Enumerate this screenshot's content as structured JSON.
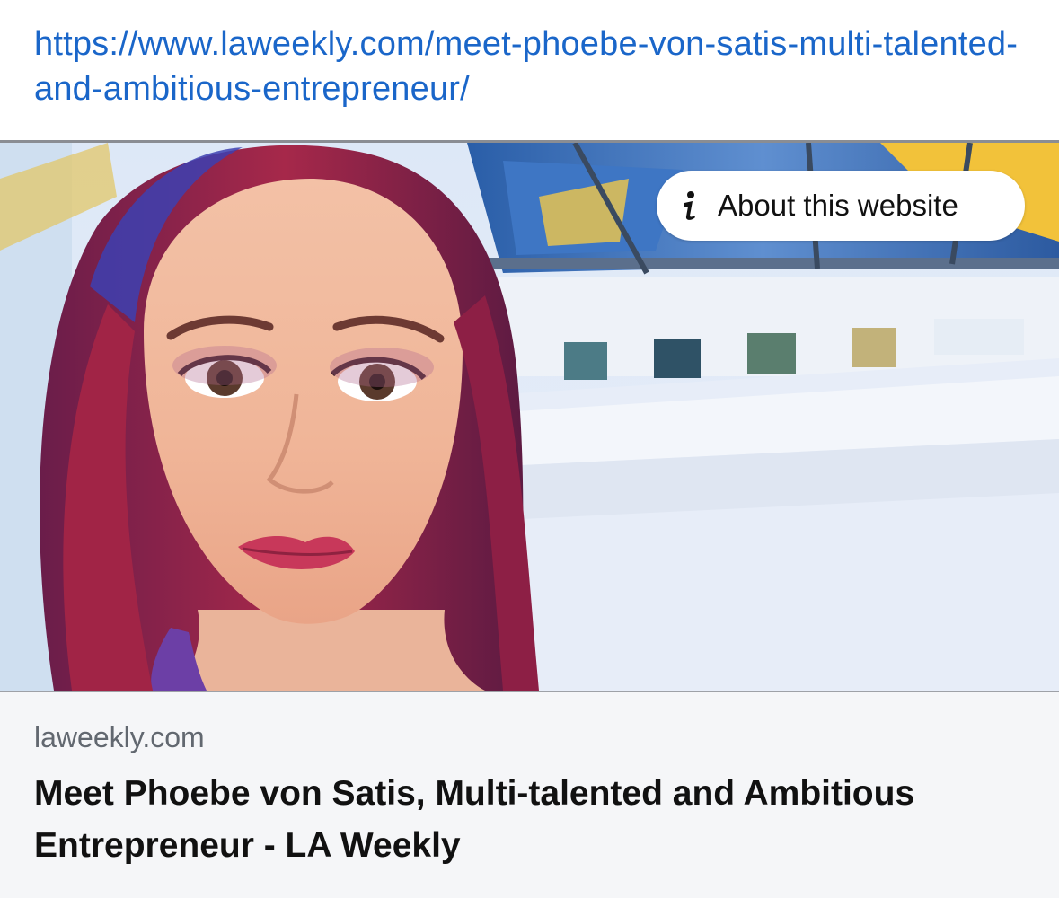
{
  "link": {
    "url": "https://www.laweekly.com/meet-phoebe-von-satis-multi-talented-and-ambitious-entrepreneur/"
  },
  "preview": {
    "about_label": "About this website",
    "domain": "laweekly.com",
    "title": "Meet Phoebe von Satis, Multi-talented and Ambitious Entrepreneur - LA Weekly"
  },
  "colors": {
    "link": "#1a66c9",
    "card_bg": "#f5f6f8",
    "domain_text": "#626870",
    "title_text": "#111111"
  },
  "icons": {
    "about": "info-icon"
  }
}
